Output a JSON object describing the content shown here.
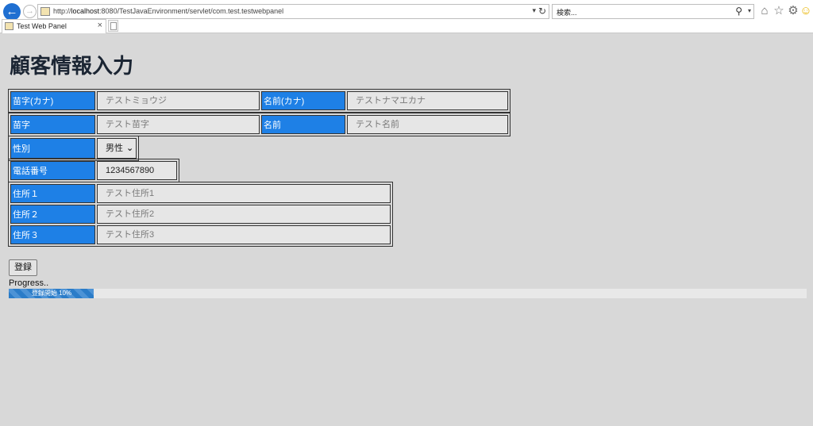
{
  "browser": {
    "url_prefix": "http://",
    "url_host": "localhost",
    "url_rest": ":8080/TestJavaEnvironment/servlet/com.test.testwebpanel",
    "search_placeholder": "検索...",
    "tab_title": "Test Web Panel"
  },
  "page": {
    "title": "顧客情報入力"
  },
  "form": {
    "sei_kana": {
      "label": "苗字(カナ)",
      "placeholder": "テストミョウジ"
    },
    "mei_kana": {
      "label": "名前(カナ)",
      "placeholder": "テストナマエカナ"
    },
    "sei": {
      "label": "苗字",
      "placeholder": "テスト苗字"
    },
    "mei": {
      "label": "名前",
      "placeholder": "テスト名前"
    },
    "gender": {
      "label": "性別",
      "value": "男性"
    },
    "phone": {
      "label": "電話番号",
      "value": "1234567890"
    },
    "address1": {
      "label": "住所１",
      "placeholder": "テスト住所1"
    },
    "address2": {
      "label": "住所２",
      "placeholder": "テスト住所2"
    },
    "address3": {
      "label": "住所３",
      "placeholder": "テスト住所3"
    }
  },
  "actions": {
    "register_label": "登録"
  },
  "progress": {
    "label": "Progress..",
    "bar_text": "登録開始 10%",
    "percent": 10.6
  },
  "colors": {
    "label_bg": "#1e80e6",
    "progress_fill": "#2b7cc8"
  }
}
